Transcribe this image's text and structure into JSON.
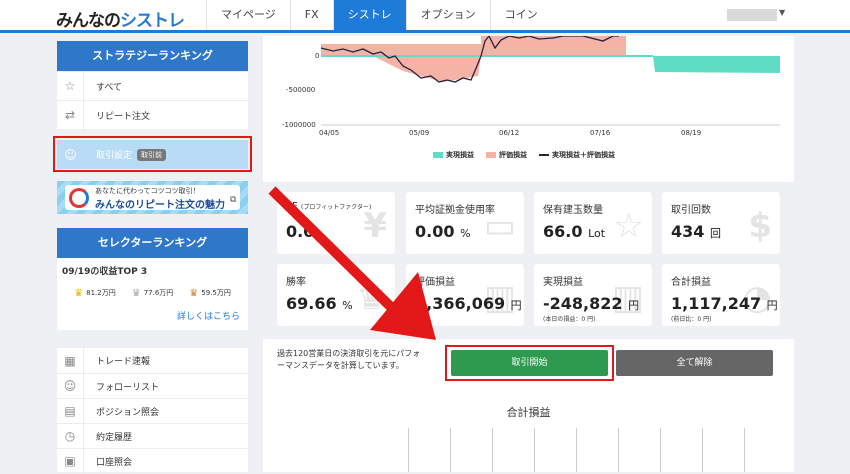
{
  "header": {
    "logo_a": "みんなの",
    "logo_b": "シストレ",
    "nav": [
      "マイページ",
      "FX",
      "シストレ",
      "オプション",
      "コイン"
    ]
  },
  "sidebar": {
    "strategy_title": "ストラテジーランキング",
    "strategy_items": [
      {
        "label": "すべて",
        "icon": "star-icon"
      },
      {
        "label": "リピート注文",
        "icon": "repeat-icon"
      }
    ],
    "trade_settings": {
      "label": "取引設定",
      "badge": "取引前"
    },
    "banner": {
      "small": "あなたに代わってコツコツ取引！",
      "big": "みんなのリピート注文の魅力"
    },
    "selector_title": "セレクターランキング",
    "selector_subtitle": "09/19の収益TOP 3",
    "top3": [
      {
        "value": "81.2万円",
        "color": "#e6b800"
      },
      {
        "value": "77.6万円",
        "color": "#a8a8a8"
      },
      {
        "value": "59.5万円",
        "color": "#d9822b"
      }
    ],
    "more_link": "詳しくはこちら",
    "menu": [
      {
        "label": "トレード速報",
        "icon": "calculator-icon"
      },
      {
        "label": "フォローリスト",
        "icon": "user-icon"
      },
      {
        "label": "ポジション照会",
        "icon": "book-icon"
      },
      {
        "label": "約定履歴",
        "icon": "clock-icon"
      },
      {
        "label": "口座照会",
        "icon": "account-icon"
      }
    ]
  },
  "chart": {
    "y_ticks": [
      "0",
      "-500000",
      "-1000000"
    ],
    "x_ticks": [
      "04/05",
      "05/09",
      "06/12",
      "07/16",
      "08/19"
    ],
    "legend": [
      "実現損益",
      "評価損益",
      "実現損益＋評価損益"
    ],
    "colors": {
      "realized": "#5fdcc4",
      "unrealized": "#f5b3a5",
      "total": "#2a1f3d"
    }
  },
  "metrics": [
    {
      "label": "PF",
      "label_small": "(プロフィットファクター)",
      "value": "0.0",
      "unit": "",
      "sub": "",
      "glyph": "¥"
    },
    {
      "label": "平均証拠金使用率",
      "label_small": "",
      "value": "0.00",
      "unit": "%",
      "sub": "",
      "glyph": "▭"
    },
    {
      "label": "保有建玉数量",
      "label_small": "",
      "value": "66.0",
      "unit": "Lot",
      "sub": "",
      "glyph": "☆"
    },
    {
      "label": "取引回数",
      "label_small": "",
      "value": "434",
      "unit": "回",
      "sub": "",
      "glyph": "$"
    },
    {
      "label": "勝率",
      "label_small": "",
      "value": "69.66",
      "unit": "%",
      "sub": "",
      "glyph": "♛"
    },
    {
      "label": "評価損益",
      "label_small": "",
      "value": "1,366,069",
      "unit": "円",
      "sub": "",
      "glyph": "▥"
    },
    {
      "label": "実現損益",
      "label_small": "",
      "value": "-248,822",
      "unit": "円",
      "sub": "(本日の損益：0 円)",
      "glyph": "▥"
    },
    {
      "label": "合計損益",
      "label_small": "",
      "value": "1,117,247",
      "unit": "円",
      "sub": "(前日比：0 円)",
      "glyph": "◔"
    }
  ],
  "notice": "過去120営業日の決済取引を元にパフォーマンスデータを計算しています。",
  "buttons": {
    "start": "取引開始",
    "clear": "全て解除"
  },
  "total_title": "合計損益"
}
